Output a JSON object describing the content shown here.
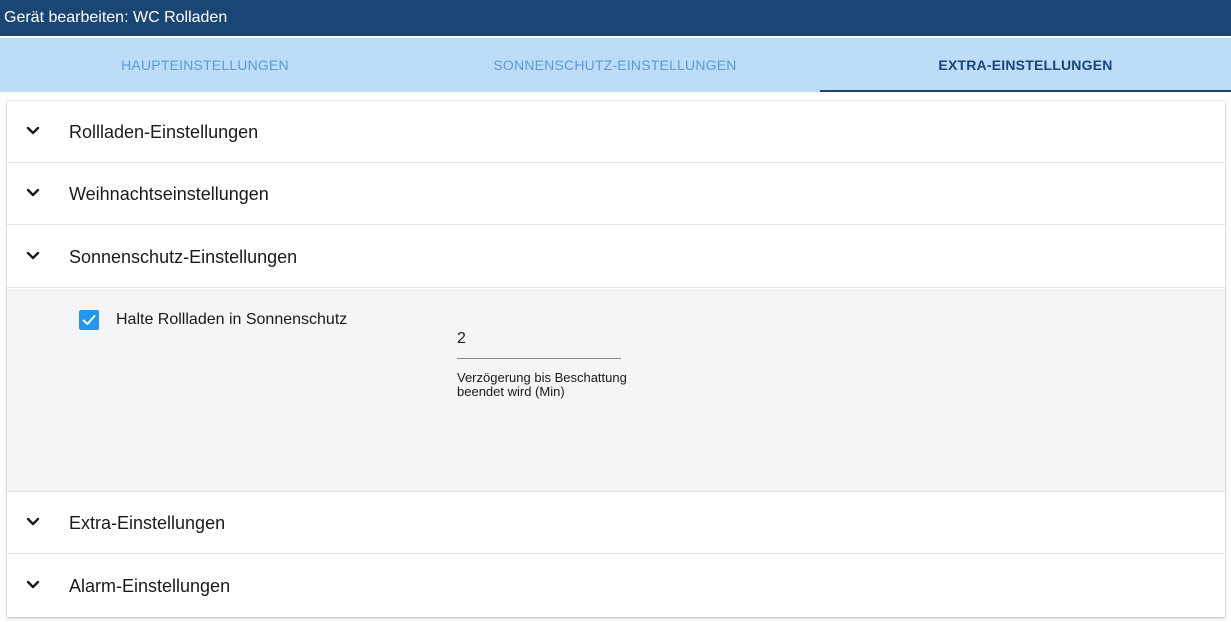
{
  "window": {
    "title": "Gerät bearbeiten: WC Rolladen"
  },
  "tabs": [
    {
      "label": "HAUPTEINSTELLUNGEN",
      "active": false
    },
    {
      "label": "SONNENSCHUTZ-EINSTELLUNGEN",
      "active": false
    },
    {
      "label": "EXTRA-EINSTELLUNGEN",
      "active": true
    }
  ],
  "sections": [
    {
      "label": "Rollladen-Einstellungen",
      "expanded": false
    },
    {
      "label": "Weihnachtseinstellungen",
      "expanded": false
    },
    {
      "label": "Sonnenschutz-Einstellungen",
      "expanded": true
    },
    {
      "label": "Extra-Einstellungen",
      "expanded": false
    },
    {
      "label": "Alarm-Einstellungen",
      "expanded": false
    }
  ],
  "sonnenschutz": {
    "hold_checkbox": {
      "label": "Halte Rollladen in Sonnenschutz",
      "checked": true
    },
    "delay_field": {
      "value": "2",
      "helper": "Verzögerung bis Beschattung beendet wird (Min)"
    }
  },
  "icons": {
    "section_toggle": "chevron-down-icon",
    "checkbox_mark": "checkmark-icon"
  },
  "colors": {
    "titlebar_bg": "#1b4575",
    "tabbar_bg": "#bcdcf7",
    "tab_inactive_text": "#5a9bd5",
    "tab_active_text": "#1b4575",
    "checkbox_accent": "#2196f3"
  }
}
